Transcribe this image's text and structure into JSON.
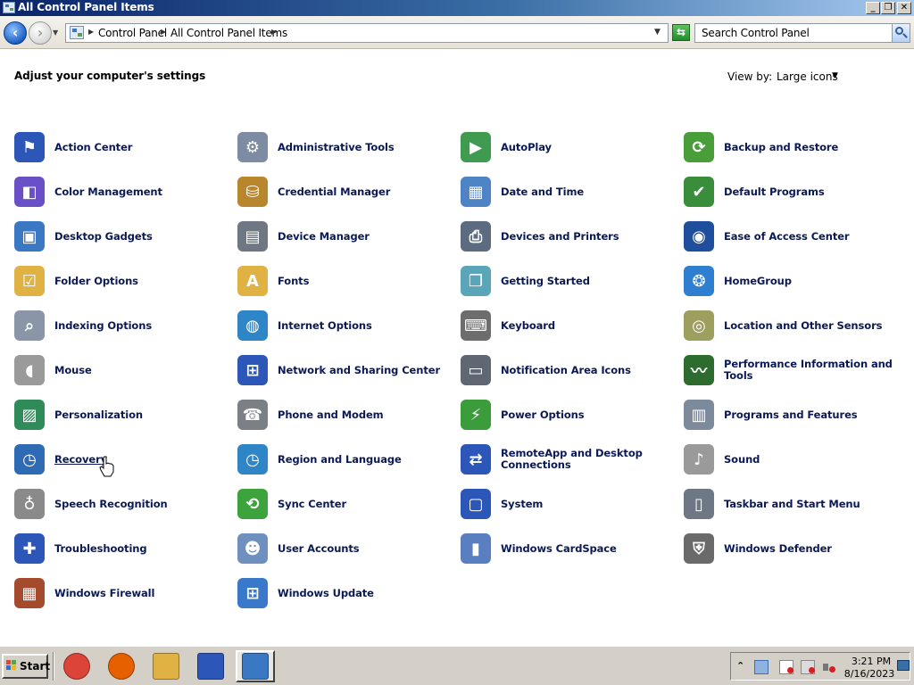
{
  "window": {
    "title": "All Control Panel Items",
    "buttons": {
      "minimize": "_",
      "maximize": "❐",
      "close": "✕"
    }
  },
  "address_bar": {
    "breadcrumbs": [
      "Control Panel",
      "All Control Panel Items"
    ],
    "search_placeholder": "Search Control Panel"
  },
  "content": {
    "heading": "Adjust your computer's settings",
    "view_by_label": "View by:",
    "view_by_value": "Large icons",
    "items": [
      {
        "label": "Action Center",
        "icon": "flag-icon",
        "color": "#2c56b8",
        "glyph": "⚑"
      },
      {
        "label": "Administrative Tools",
        "icon": "admin-tools-icon",
        "color": "#7d8ba3",
        "glyph": "⚙"
      },
      {
        "label": "AutoPlay",
        "icon": "autoplay-icon",
        "color": "#3f9b4f",
        "glyph": "▶"
      },
      {
        "label": "Backup and Restore",
        "icon": "backup-icon",
        "color": "#4a9e3a",
        "glyph": "⟳"
      },
      {
        "label": "Color Management",
        "icon": "color-management-icon",
        "color": "#6b4fc7",
        "glyph": "◧"
      },
      {
        "label": "Credential Manager",
        "icon": "credential-manager-icon",
        "color": "#b8862d",
        "glyph": "⛁"
      },
      {
        "label": "Date and Time",
        "icon": "calendar-icon",
        "color": "#4e84c6",
        "glyph": "▦"
      },
      {
        "label": "Default Programs",
        "icon": "default-programs-icon",
        "color": "#3a8d3a",
        "glyph": "✔"
      },
      {
        "label": "Desktop Gadgets",
        "icon": "desktop-gadgets-icon",
        "color": "#3b78c4",
        "glyph": "▣"
      },
      {
        "label": "Device Manager",
        "icon": "device-manager-icon",
        "color": "#6f7782",
        "glyph": "▤"
      },
      {
        "label": "Devices and Printers",
        "icon": "printer-icon",
        "color": "#5c6b80",
        "glyph": "⎙"
      },
      {
        "label": "Ease of Access Center",
        "icon": "ease-of-access-icon",
        "color": "#1f4f9c",
        "glyph": "◉"
      },
      {
        "label": "Folder Options",
        "icon": "folder-options-icon",
        "color": "#e0b243",
        "glyph": "☑"
      },
      {
        "label": "Fonts",
        "icon": "fonts-icon",
        "color": "#e0b243",
        "glyph": "A"
      },
      {
        "label": "Getting Started",
        "icon": "getting-started-icon",
        "color": "#5aa6b8",
        "glyph": "❐"
      },
      {
        "label": "HomeGroup",
        "icon": "homegroup-icon",
        "color": "#2f7fd0",
        "glyph": "❂"
      },
      {
        "label": "Indexing Options",
        "icon": "indexing-icon",
        "color": "#8a96a8",
        "glyph": "⌕"
      },
      {
        "label": "Internet Options",
        "icon": "internet-options-icon",
        "color": "#2f86c7",
        "glyph": "◍"
      },
      {
        "label": "Keyboard",
        "icon": "keyboard-icon",
        "color": "#6d6d6d",
        "glyph": "⌨"
      },
      {
        "label": "Location and Other Sensors",
        "icon": "sensors-icon",
        "color": "#9c9f5d",
        "glyph": "◎"
      },
      {
        "label": "Mouse",
        "icon": "mouse-icon",
        "color": "#9a9a9a",
        "glyph": "◖"
      },
      {
        "label": "Network and Sharing Center",
        "icon": "network-icon",
        "color": "#2c56b8",
        "glyph": "⊞"
      },
      {
        "label": "Notification Area Icons",
        "icon": "notification-area-icon",
        "color": "#5e6772",
        "glyph": "▭"
      },
      {
        "label": "Performance Information and Tools",
        "icon": "performance-icon",
        "color": "#2e6b2e",
        "glyph": "〰"
      },
      {
        "label": "Personalization",
        "icon": "personalization-icon",
        "color": "#2f8c5a",
        "glyph": "▨"
      },
      {
        "label": "Phone and Modem",
        "icon": "phone-icon",
        "color": "#7b7f86",
        "glyph": "☎"
      },
      {
        "label": "Power Options",
        "icon": "power-options-icon",
        "color": "#3b9c3b",
        "glyph": "⚡"
      },
      {
        "label": "Programs and Features",
        "icon": "programs-features-icon",
        "color": "#7d8a9c",
        "glyph": "▥"
      },
      {
        "label": "Recovery",
        "icon": "recovery-icon",
        "color": "#2f6bb5",
        "glyph": "◷"
      },
      {
        "label": "Region and Language",
        "icon": "region-language-icon",
        "color": "#2f86c7",
        "glyph": "◷"
      },
      {
        "label": "RemoteApp and Desktop Connections",
        "icon": "remoteapp-icon",
        "color": "#2c56b8",
        "glyph": "⇄"
      },
      {
        "label": "Sound",
        "icon": "sound-icon",
        "color": "#9a9a9a",
        "glyph": "♪"
      },
      {
        "label": "Speech Recognition",
        "icon": "microphone-icon",
        "color": "#8a8a8a",
        "glyph": "♁"
      },
      {
        "label": "Sync Center",
        "icon": "sync-center-icon",
        "color": "#3da33d",
        "glyph": "⟲"
      },
      {
        "label": "System",
        "icon": "system-icon",
        "color": "#2c56b8",
        "glyph": "▢"
      },
      {
        "label": "Taskbar and Start Menu",
        "icon": "taskbar-icon",
        "color": "#6e7784",
        "glyph": "▯"
      },
      {
        "label": "Troubleshooting",
        "icon": "troubleshooting-icon",
        "color": "#2c56b8",
        "glyph": "✚"
      },
      {
        "label": "User Accounts",
        "icon": "user-accounts-icon",
        "color": "#6f8fbf",
        "glyph": "☻"
      },
      {
        "label": "Windows CardSpace",
        "icon": "cardspace-icon",
        "color": "#5a7fc0",
        "glyph": "▮"
      },
      {
        "label": "Windows Defender",
        "icon": "defender-icon",
        "color": "#6a6a6a",
        "glyph": "⛨"
      },
      {
        "label": "Windows Firewall",
        "icon": "firewall-icon",
        "color": "#a34b2c",
        "glyph": "▦"
      },
      {
        "label": "Windows Update",
        "icon": "windows-update-icon",
        "color": "#3a78c9",
        "glyph": "⊞"
      }
    ]
  },
  "taskbar": {
    "start_label": "Start",
    "apps": [
      {
        "name": "chrome-icon",
        "color": "#db4437"
      },
      {
        "name": "firefox-icon",
        "color": "#e66000"
      },
      {
        "name": "file-explorer-icon",
        "color": "#e0b243"
      },
      {
        "name": "remote-desktop-icon",
        "color": "#2c56b8"
      },
      {
        "name": "control-panel-icon",
        "color": "#3b78c4"
      }
    ],
    "clock_time": "3:21 PM",
    "clock_date": "8/16/2023"
  }
}
